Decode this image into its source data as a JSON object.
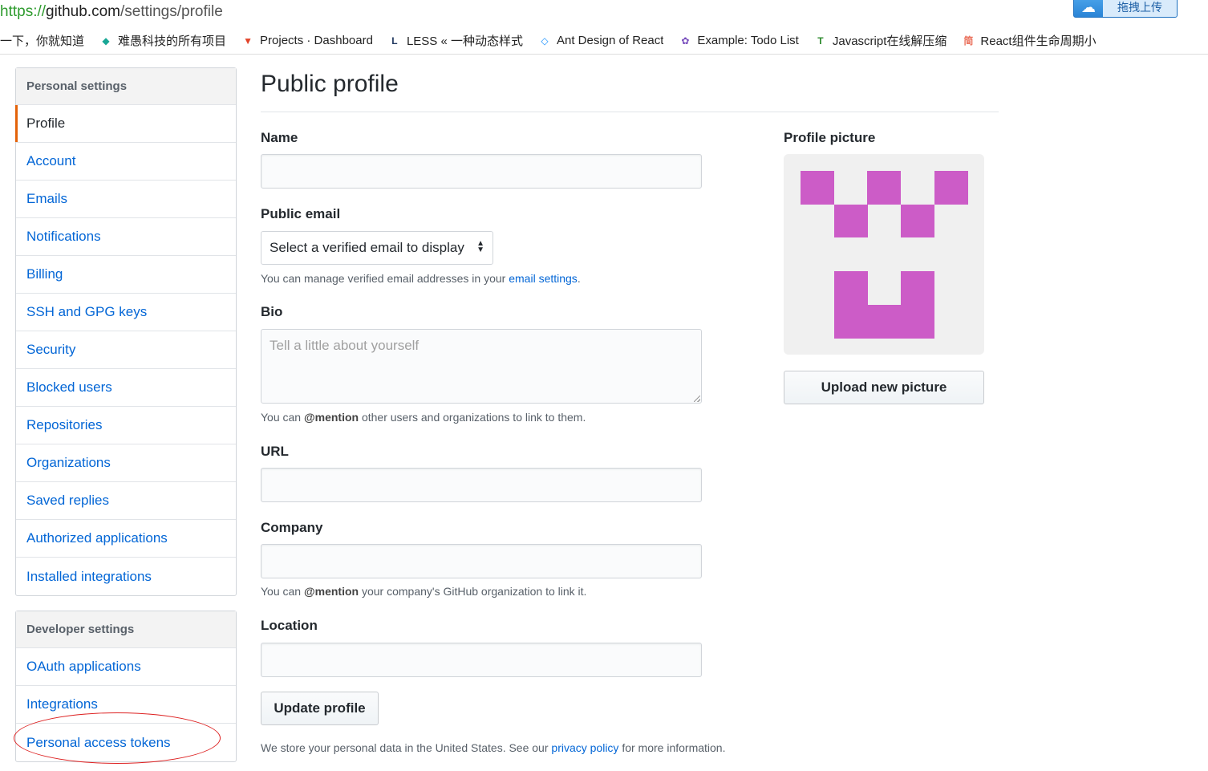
{
  "browser": {
    "url_scheme": "https://",
    "url_host": "github.com",
    "url_path": "/settings/profile",
    "upload_button_label": "拖拽上传",
    "bookmarks": [
      {
        "label": "一下，你就知道",
        "icon": "none-icon",
        "color": "#ffffff"
      },
      {
        "label": "难愚科技的所有项目",
        "icon": "tag-icon",
        "color": "#19a796"
      },
      {
        "label": "Projects · Dashboard",
        "icon": "gitlab-icon",
        "color": "#e24329"
      },
      {
        "label": "LESS « 一种动态样式",
        "icon": "less-icon",
        "color": "#1d365d"
      },
      {
        "label": "Ant Design of React",
        "icon": "ant-design-icon",
        "color": "#1890ff"
      },
      {
        "label": "Example: Todo List",
        "icon": "redux-icon",
        "color": "#764abc"
      },
      {
        "label": "Javascript在线解压缩",
        "icon": "tool-icon",
        "color": "#2c8a2c"
      },
      {
        "label": "React组件生命周期小",
        "icon": "jianshu-icon",
        "color": "#ea6f5a"
      }
    ]
  },
  "sidebar": {
    "personal_header": "Personal settings",
    "personal_items": [
      {
        "label": "Profile",
        "selected": true
      },
      {
        "label": "Account"
      },
      {
        "label": "Emails"
      },
      {
        "label": "Notifications"
      },
      {
        "label": "Billing"
      },
      {
        "label": "SSH and GPG keys"
      },
      {
        "label": "Security"
      },
      {
        "label": "Blocked users"
      },
      {
        "label": "Repositories"
      },
      {
        "label": "Organizations"
      },
      {
        "label": "Saved replies"
      },
      {
        "label": "Authorized applications"
      },
      {
        "label": "Installed integrations"
      }
    ],
    "developer_header": "Developer settings",
    "developer_items": [
      {
        "label": "OAuth applications"
      },
      {
        "label": "Integrations"
      },
      {
        "label": "Personal access tokens"
      }
    ]
  },
  "main": {
    "title": "Public profile",
    "name_label": "Name",
    "name_value": "",
    "email_label": "Public email",
    "email_select": "Select a verified email to display",
    "email_note_prefix": "You can manage verified email addresses in your ",
    "email_note_link": "email settings",
    "email_note_suffix": ".",
    "bio_label": "Bio",
    "bio_placeholder": "Tell a little about yourself",
    "bio_note_prefix": "You can ",
    "bio_note_mention": "@mention",
    "bio_note_suffix": " other users and organizations to link to them.",
    "url_label": "URL",
    "company_label": "Company",
    "company_note_prefix": "You can ",
    "company_note_mention": "@mention",
    "company_note_suffix": " your company's GitHub organization to link it.",
    "location_label": "Location",
    "update_button": "Update profile",
    "footer_prefix": "We store your personal data in the United States. See our ",
    "footer_link": "privacy policy",
    "footer_suffix": " for more information."
  },
  "profile_picture": {
    "label": "Profile picture",
    "upload_button": "Upload new picture",
    "identicon_color": "#cc5cc7"
  },
  "colors": {
    "link": "#0366d6",
    "selected_marker": "#e36209",
    "annotation_circle": "#dd2222"
  }
}
